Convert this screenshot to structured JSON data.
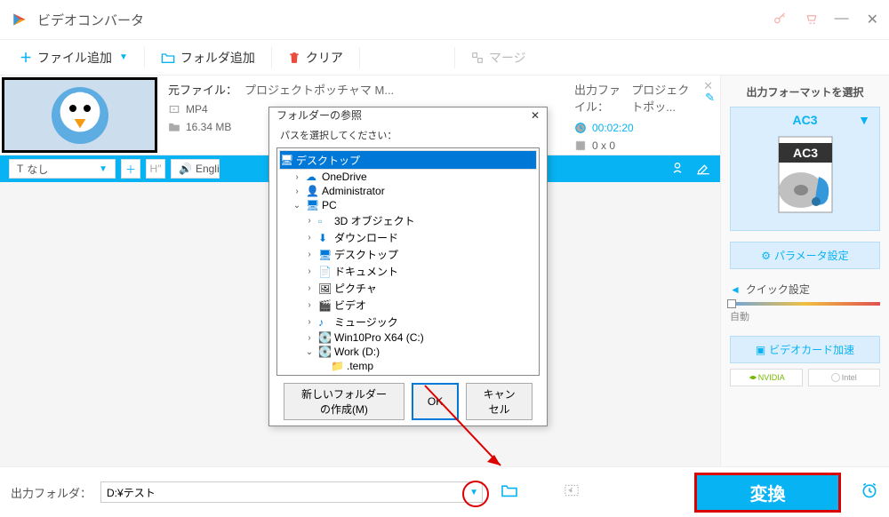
{
  "title": "ビデオコンバータ",
  "toolbar": {
    "add_file": "ファイル追加",
    "add_folder": "フォルダ追加",
    "clear": "クリア",
    "merge": "マージ"
  },
  "item": {
    "source_label": "元ファイル：",
    "source_name": "プロジェクトポッチャマ M...",
    "format": "MP4",
    "size": "16.34 MB",
    "output_label": "出力ファイル：",
    "output_name": "プロジェクトポッ...",
    "duration": "00:02:20",
    "dimensions": "0 x 0",
    "subtitle_label": "なし",
    "audio_label": "Engli"
  },
  "right": {
    "header": "出力フォーマットを選択",
    "format": "AC3",
    "param_btn": "パラメータ設定",
    "quick_label": "クイック設定",
    "slider_label": "自動",
    "gpu_label": "ビデオカード加速",
    "nvidia": "NVIDIA",
    "intel": "Intel"
  },
  "footer": {
    "label": "出力フォルダ：",
    "path": "D:¥テスト",
    "convert": "変換"
  },
  "dialog": {
    "title": "フォルダーの参照",
    "prompt": "パスを選択してください：",
    "tree": {
      "desktop": "デスクトップ",
      "onedrive": "OneDrive",
      "admin": "Administrator",
      "pc": "PC",
      "objects3d": "3D オブジェクト",
      "downloads": "ダウンロード",
      "desktop2": "デスクトップ",
      "documents": "ドキュメント",
      "pictures": "ピクチャ",
      "videos": "ビデオ",
      "music": "ミュージック",
      "cdrive": "Win10Pro X64 (C:)",
      "ddrive": "Work (D:)",
      "temp": ".temp"
    },
    "new_folder": "新しいフォルダーの作成(M)",
    "ok": "OK",
    "cancel": "キャンセル"
  }
}
